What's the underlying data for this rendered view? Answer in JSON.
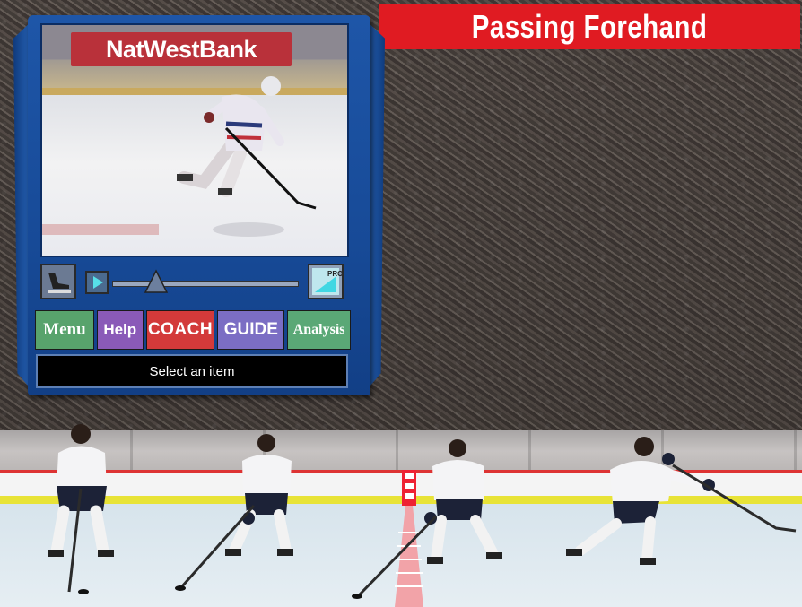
{
  "title": "Passing Forehand",
  "video": {
    "ad_text": "NatWestBank"
  },
  "controls": {
    "pro_label": "PRO"
  },
  "nav": {
    "menu": "Menu",
    "help": "Help",
    "coach": "COACH",
    "guide": "GUIDE",
    "analysis": "Analysis"
  },
  "status": "Select an item",
  "colors": {
    "title_banner": "#e01b22",
    "panel": "#1e56a8",
    "menu": "#58a36c",
    "help": "#8a5ab8",
    "coach": "#d33a3a",
    "guide": "#7b6ec4",
    "analysis": "#5aa876"
  }
}
